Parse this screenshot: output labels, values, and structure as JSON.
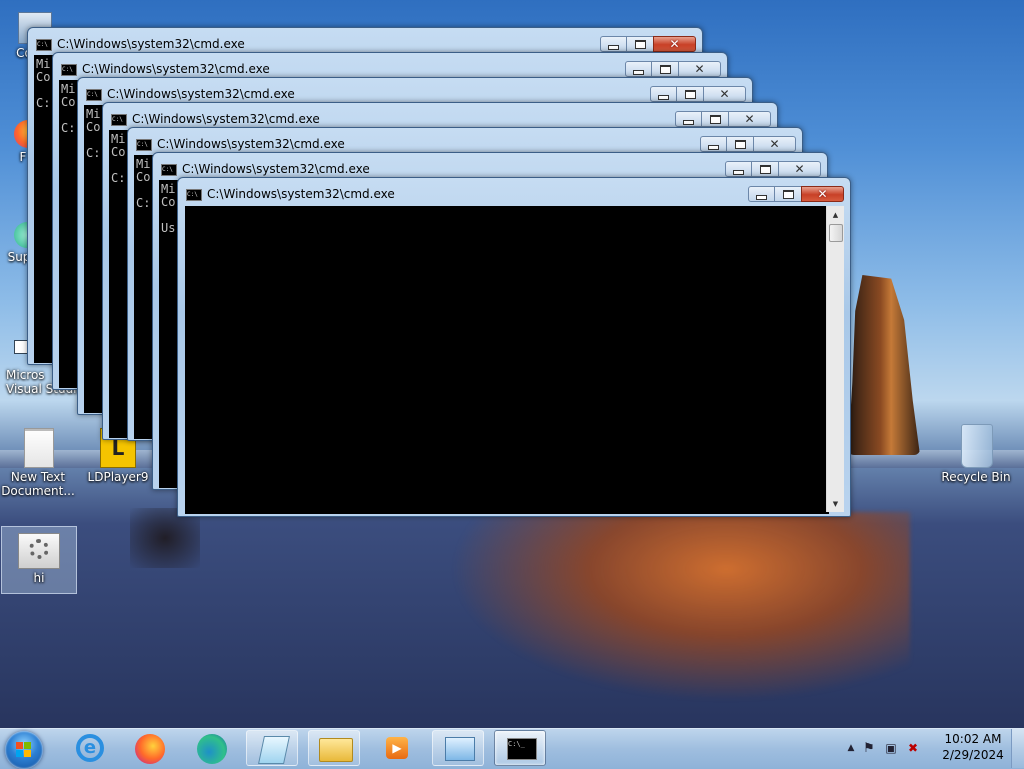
{
  "desktop_icons": [
    {
      "id": "computer",
      "label": "Co"
    },
    {
      "id": "firefox-shortcut",
      "label": "F"
    },
    {
      "id": "support",
      "label": "Sup"
    },
    {
      "id": "visual-studio",
      "label": "Micros\nVisual Studi..."
    },
    {
      "id": "new-text-document",
      "label": "New Text\nDocument..."
    },
    {
      "id": "ldplayer9",
      "label": "LDPlayer9"
    },
    {
      "id": "hi",
      "label": "hi"
    },
    {
      "id": "recycle-bin",
      "label": "Recycle Bin"
    }
  ],
  "windows": [
    {
      "title": "C:\\Windows\\system32\\cmd.exe",
      "console": "Mi\nCo\n\nC:"
    },
    {
      "title": "C:\\Windows\\system32\\cmd.exe",
      "console": "Mi\nCo\n\nC:"
    },
    {
      "title": "C:\\Windows\\system32\\cmd.exe",
      "console": "Mi\nCo\n\nC:"
    },
    {
      "title": "C:\\Windows\\system32\\cmd.exe",
      "console": "Mi\nCo\n\nC:"
    },
    {
      "title": "C:\\Windows\\system32\\cmd.exe",
      "console": "Mi\nCo\n\nC:"
    },
    {
      "title": "C:\\Windows\\system32\\cmd.exe",
      "console": "Mi\nCo\n\nUs"
    },
    {
      "title": "C:\\Windows\\system32\\cmd.exe",
      "console": ""
    }
  ],
  "taskbar": {
    "pinned": [
      "start-button",
      "internet-explorer",
      "firefox",
      "edge",
      "notepad",
      "file-explorer",
      "media-player",
      "control-panel",
      "command-prompt"
    ],
    "clock": {
      "time": "10:02 AM",
      "date": "2/29/2024"
    }
  },
  "colors": {
    "console_bg": "#000000",
    "close_red": "#c84027",
    "title_glass": "#b9d3ee"
  }
}
